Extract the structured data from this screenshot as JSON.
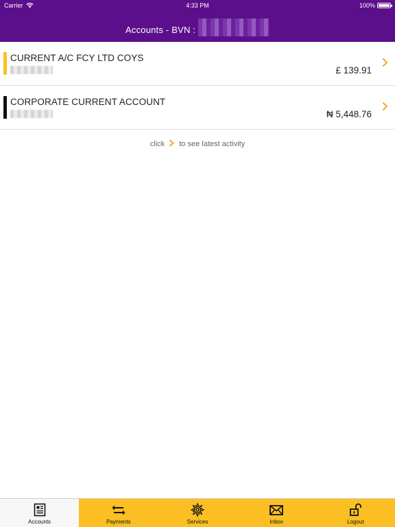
{
  "status_bar": {
    "carrier": "Carrier",
    "time": "4:33 PM",
    "battery": "100%"
  },
  "header": {
    "title": "Accounts - BVN :"
  },
  "accounts": [
    {
      "name": "CURRENT A/C FCY LTD COYS",
      "balance": "£ 139.91",
      "accent_color": "#fbbf24"
    },
    {
      "name": "CORPORATE CURRENT ACCOUNT",
      "balance": "₦ 5,448.76",
      "accent_color": "#111111"
    }
  ],
  "hint": {
    "before": "click",
    "after": "to see latest activity"
  },
  "tabs": [
    {
      "label": "Accounts",
      "icon": "accounts-icon",
      "active": true
    },
    {
      "label": "Payments",
      "icon": "transfer-arrows-icon",
      "active": false
    },
    {
      "label": "Services",
      "icon": "gear-icon",
      "active": false
    },
    {
      "label": "Inbox",
      "icon": "envelope-icon",
      "active": false
    },
    {
      "label": "Logout",
      "icon": "unlock-icon",
      "active": false
    }
  ],
  "colors": {
    "brand_purple": "#5c0f8b",
    "accent_yellow": "#fbbf24",
    "chevron": "#f5a623"
  }
}
